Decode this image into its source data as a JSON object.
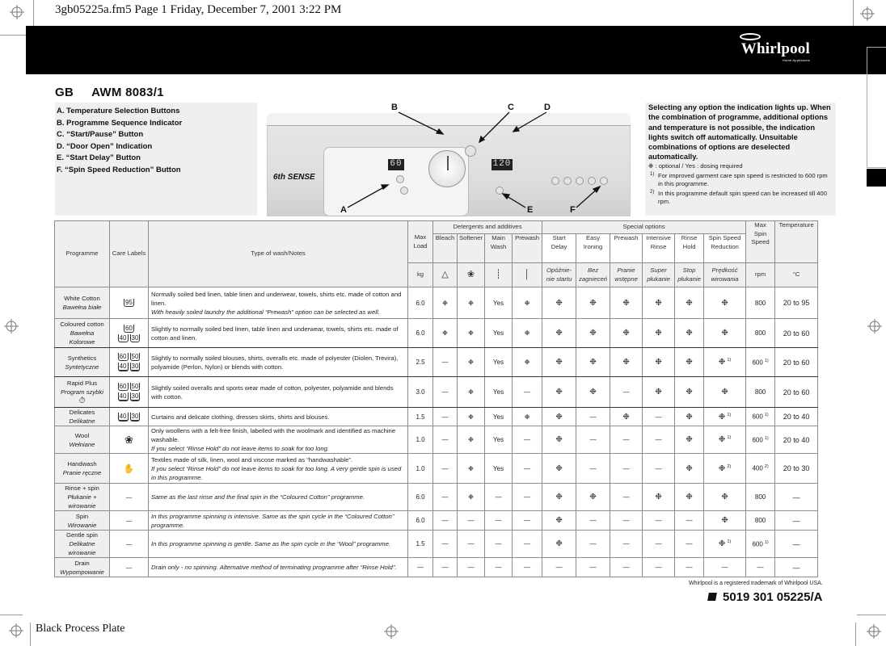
{
  "slug": "3gb05225a.fm5  Page 1  Friday, December 7, 2001  3:22 PM",
  "brand": {
    "name": "Whirlpool",
    "tagline": "Home Appliances"
  },
  "model": {
    "country": "GB",
    "number": "AWM 8083/1"
  },
  "legend": [
    "A. Temperature Selection Buttons",
    "B. Programme Sequence Indicator",
    "C. “Start/Pause” Button",
    "D. “Door Open” Indication",
    "E. “Start Delay” Button",
    "F.  “Spin Speed Reduction” Button"
  ],
  "panel": {
    "callouts": [
      "A",
      "B",
      "C",
      "D",
      "E",
      "F"
    ],
    "temp_display": "60",
    "time_display": "120",
    "badge": "6th SENSE"
  },
  "info": {
    "bold_text": "Selecting any option the indication lights up. When the combination of programme, additional options and temperature is not possible, the indication lights switch off automatically. Unsuitable combinations of options are deselected automatically.",
    "key": "❉ : optional / Yes : dosing required",
    "notes": [
      {
        "mark": "1)",
        "text": "For improved garment care spin speed is restricted to 600 rpm in this programme."
      },
      {
        "mark": "2)",
        "text": "In this programme default spin speed can be increased till 400 rpm."
      }
    ]
  },
  "table": {
    "headers": {
      "programme": "Programme",
      "care_labels": "Care Labels",
      "type": "Type of wash/Notes",
      "max_load": "Max Load",
      "max_load_unit": "kg",
      "detergents_group": "Detergents and additives",
      "special_group": "Special options",
      "max_spin": "Max Spin Speed",
      "max_spin_unit": "rpm",
      "temperature": "Temperature",
      "temperature_unit": "°C",
      "detergent_cols": [
        "Bleach",
        "Softener",
        "Main Wash",
        "Prewash"
      ],
      "special_cols": [
        {
          "en": "Start Delay",
          "pl": "Opóźnie-nie startu"
        },
        {
          "en": "Easy Ironing",
          "pl": "Bez zagnieceń"
        },
        {
          "en": "Prewash",
          "pl": "Pranie wstępne"
        },
        {
          "en": "Intensive Rinse",
          "pl": "Super płukanie"
        },
        {
          "en": "Rinse Hold",
          "pl": "Stop płukanie"
        },
        {
          "en": "Spin Speed Reduction",
          "pl": "Prędkość wirowania"
        }
      ]
    },
    "rows": [
      {
        "name": "White Cotton",
        "name_pl": "Bawełna białe",
        "care": [
          "95"
        ],
        "notes": "Normally soiled bed linen, table linen and underwear, towels, shirts etc. made of cotton and linen.",
        "notes_it": "With heavily soiled laundry the additional “Prewash” option can be selected as well.",
        "load": "6.0",
        "det": [
          "❉",
          "❉",
          "Yes",
          "❉"
        ],
        "spec": [
          "❉",
          "❉",
          "❉",
          "❉",
          "❉",
          "❉"
        ],
        "spec_sup": "",
        "spin": "800",
        "spin_sup": "",
        "temp": "20 to 95"
      },
      {
        "name": "Coloured cotton",
        "name_pl": "Bawełna Kolorowe",
        "care": [
          "60",
          "40",
          "30"
        ],
        "notes": "Slightly to normally soiled bed linen, table linen and underwear, towels, shirts etc. made of cotton and linen.",
        "notes_it": "",
        "load": "6.0",
        "det": [
          "❉",
          "❉",
          "Yes",
          "❉"
        ],
        "spec": [
          "❉",
          "❉",
          "❉",
          "❉",
          "❉",
          "❉"
        ],
        "spec_sup": "",
        "spin": "800",
        "spin_sup": "",
        "temp": "20 to 60"
      },
      {
        "name": "Synthetics",
        "name_pl": "Syntetyczne",
        "care": [
          "60",
          "50",
          "40",
          "30"
        ],
        "notes": "Slightly to normally soiled blouses, shirts, overalls etc. made of polyester (Diolen, Trevira), polyamide (Perlon, Nylon) or blends with cotton.",
        "notes_it": "",
        "load": "2.5",
        "det": [
          "—",
          "❉",
          "Yes",
          "❉"
        ],
        "spec": [
          "❉",
          "❉",
          "❉",
          "❉",
          "❉",
          "❉"
        ],
        "spec_sup": "1)",
        "spin": "600",
        "spin_sup": "1)",
        "temp": "20 to 60"
      },
      {
        "name": "Rapid Plus",
        "name_pl": "Program szybki",
        "care": [
          "60",
          "50",
          "40",
          "30"
        ],
        "notes": "Slightly soiled overalls and sports wear made of cotton, polyester, polyamide and blends with cotton.",
        "notes_it": "",
        "load": "3.0",
        "det": [
          "—",
          "❉",
          "Yes",
          "—"
        ],
        "spec": [
          "❉",
          "❉",
          "—",
          "❉",
          "❉",
          "❉"
        ],
        "spec_sup": "",
        "spin": "800",
        "spin_sup": "",
        "temp": "20 to 60"
      },
      {
        "name": "Delicates",
        "name_pl": "Delikatne",
        "care": [
          "40",
          "30"
        ],
        "notes": "Curtains and delicate clothing, dresses skirts, shirts and blouses.",
        "notes_it": "",
        "load": "1.5",
        "det": [
          "—",
          "❉",
          "Yes",
          "❉"
        ],
        "spec": [
          "❉",
          "—",
          "❉",
          "—",
          "❉",
          "❉"
        ],
        "spec_sup": "1)",
        "spin": "600",
        "spin_sup": "1)",
        "temp": "20 to 40"
      },
      {
        "name": "Wool",
        "name_pl": "Wełniane",
        "care": [
          "woolmark"
        ],
        "notes": "Only woollens with a felt-free finish, labelled with the woolmark and identified as machine washable.",
        "notes_it": "If you select “Rinse Hold” do not leave items to soak for too long.",
        "load": "1.0",
        "det": [
          "—",
          "❉",
          "Yes",
          "—"
        ],
        "spec": [
          "❉",
          "—",
          "—",
          "—",
          "❉",
          "❉"
        ],
        "spec_sup": "1)",
        "spin": "600",
        "spin_sup": "1)",
        "temp": "20 to 40"
      },
      {
        "name": "Handwash",
        "name_pl": "Pranie ręczne",
        "care": [
          "handwash"
        ],
        "notes": "Textiles made of silk, linen, wool and viscose marked as “handwashable”.",
        "notes_it": "If you select “Rinse Hold” do not leave items to soak for too long. A very gentle spin is used in this programme.",
        "load": "1.0",
        "det": [
          "—",
          "❉",
          "Yes",
          "—"
        ],
        "spec": [
          "❉",
          "—",
          "—",
          "—",
          "❉",
          "❉"
        ],
        "spec_sup": "2)",
        "spin": "400",
        "spin_sup": "2)",
        "temp": "20 to 30"
      },
      {
        "name": "Rinse + spin",
        "name_pl": "Płukanie + wirowanie",
        "care": [
          "—"
        ],
        "notes": "",
        "notes_it": "Same as the last rinse and the final spin in the “Coloured Cotton” programme.",
        "load": "6.0",
        "det": [
          "—",
          "❉",
          "—",
          "—"
        ],
        "spec": [
          "❉",
          "❉",
          "—",
          "❉",
          "❉",
          "❉"
        ],
        "spec_sup": "",
        "spin": "800",
        "spin_sup": "",
        "temp": "—"
      },
      {
        "name": "Spin",
        "name_pl": "Wirowanie",
        "care": [
          "—"
        ],
        "notes": "",
        "notes_it": "In this programme spinning is intensive. Same as the spin cycle in the “Coloured Cotton” programme.",
        "load": "6.0",
        "det": [
          "—",
          "—",
          "—",
          "—"
        ],
        "spec": [
          "❉",
          "—",
          "—",
          "—",
          "—",
          "❉"
        ],
        "spec_sup": "",
        "spin": "800",
        "spin_sup": "",
        "temp": "—"
      },
      {
        "name": "Gentle spin",
        "name_pl": "Delikatne wirowanie",
        "care": [
          "—"
        ],
        "notes": "",
        "notes_it": "In this programme spinning is gentle. Same as the spin cycle in the “Wool” programme.",
        "load": "1.5",
        "det": [
          "—",
          "—",
          "—",
          "—"
        ],
        "spec": [
          "❉",
          "—",
          "—",
          "—",
          "—",
          "❉"
        ],
        "spec_sup": "1)",
        "spin": "600",
        "spin_sup": "1)",
        "temp": "—"
      },
      {
        "name": "Drain",
        "name_pl": "Wypompowanie",
        "care": [
          "—"
        ],
        "notes": "",
        "notes_it": "Drain only - no spinning. Alternative method of terminating programme after “Rinse Hold”.",
        "load": "—",
        "det": [
          "—",
          "—",
          "—",
          "—"
        ],
        "spec": [
          "—",
          "—",
          "—",
          "—",
          "—",
          "—"
        ],
        "spec_sup": "",
        "spin": "—",
        "spin_sup": "",
        "temp": "—"
      }
    ]
  },
  "footer": {
    "trademark": "Whirlpool is a registered trademark of Whirlpool USA.",
    "part_number": "5019 301 05225/A",
    "plate": "Black Process Plate"
  }
}
